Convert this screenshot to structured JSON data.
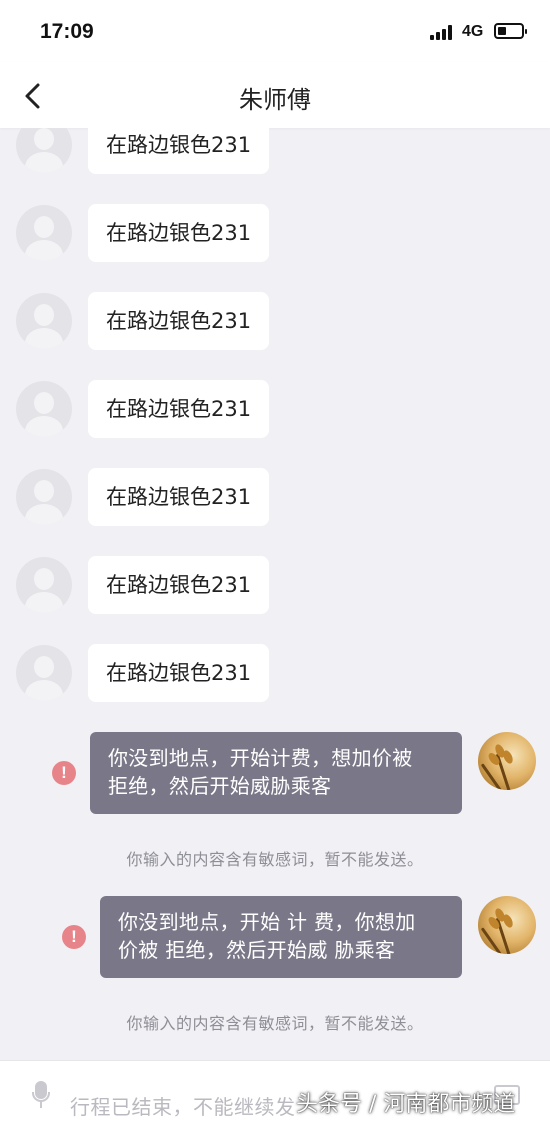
{
  "status_bar": {
    "time": "17:09",
    "network": "4G"
  },
  "header": {
    "title": "朱师傅",
    "back_icon": "chevron-left-icon"
  },
  "messages_received": [
    {
      "text": "在路边银色231"
    },
    {
      "text": "在路边银色231"
    },
    {
      "text": "在路边银色231"
    },
    {
      "text": "在路边银色231"
    },
    {
      "text": "在路边银色231"
    },
    {
      "text": "在路边银色231"
    },
    {
      "text": "在路边银色231"
    }
  ],
  "messages_sent": [
    {
      "line1": "你没到地点，开始计费，想加价被",
      "line2": "拒绝，然后开始威胁乘客",
      "status_icon": "error-icon",
      "notice": "你输入的内容含有敏感词，暂不能发送。"
    },
    {
      "line1": "你没到地点，开始 计 费，你想加",
      "line2": "价被 拒绝，然后开始威 胁乘客",
      "status_icon": "error-icon",
      "notice": "你输入的内容含有敏感词，暂不能发送。"
    }
  ],
  "error_glyph": "!",
  "input_bar": {
    "placeholder": "行程已结束，不能继续发",
    "mic_icon": "microphone-icon",
    "keyboard_icon": "keyboard-icon"
  },
  "watermark": "头条号 / 河南都市频道",
  "colors": {
    "background": "#f1f0f4",
    "sent_bubble": "#7a7888",
    "error": "#e7848a"
  }
}
